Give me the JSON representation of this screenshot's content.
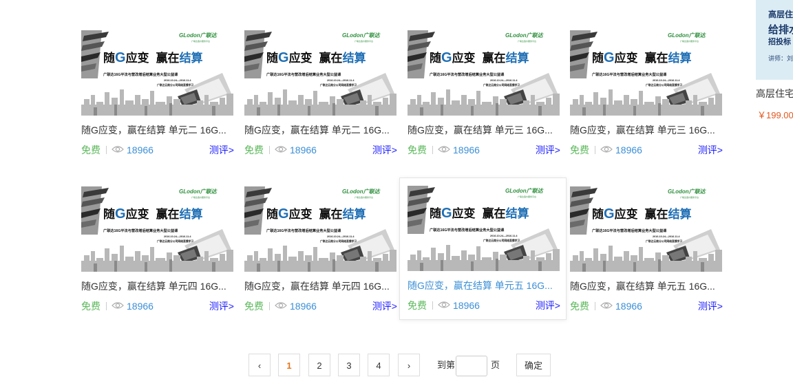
{
  "courses": [
    {
      "title": "随G应变，赢在结算 单元二 16G...",
      "price": "免费",
      "views": "18966",
      "review": "测评>",
      "thumb": {
        "logo": "GLodon广联达",
        "tagline": "广联达造价服务平台",
        "heading_a": "随",
        "heading_g": "G",
        "heading_b": "应变",
        "heading_c": "赢在",
        "heading_d": "结算",
        "subtitle": "广联达16G平法与营改增后结算业务大型公益课",
        "date": "2016.10.24—2016.11.4",
        "host": "广联达云南分公司网络直播学习"
      }
    },
    {
      "title": "随G应变，赢在结算 单元二 16G...",
      "price": "免费",
      "views": "18966",
      "review": "测评>",
      "thumb": {
        "logo": "GLodon广联达",
        "tagline": "广联达造价服务平台",
        "heading_a": "随",
        "heading_g": "G",
        "heading_b": "应变",
        "heading_c": "赢在",
        "heading_d": "结算",
        "subtitle": "广联达16G平法与营改增后结算业务大型公益课",
        "date": "2016.10.24—2016.11.4",
        "host": "广联达云南分公司网络直播学习"
      }
    },
    {
      "title": "随G应变，赢在结算 单元三 16G...",
      "price": "免费",
      "views": "18966",
      "review": "测评>",
      "thumb": {
        "logo": "GLodon广联达",
        "tagline": "广联达造价服务平台",
        "heading_a": "随",
        "heading_g": "G",
        "heading_b": "应变",
        "heading_c": "赢在",
        "heading_d": "结算",
        "subtitle": "广联达16G平法与营改增后结算业务大型公益课",
        "date": "2016.10.24—2016.11.4",
        "host": "广联达云南分公司网络直播学习"
      }
    },
    {
      "title": "随G应变，赢在结算 单元三 16G...",
      "price": "免费",
      "views": "18966",
      "review": "测评>",
      "thumb": {
        "logo": "GLodon广联达",
        "tagline": "广联达造价服务平台",
        "heading_a": "随",
        "heading_g": "G",
        "heading_b": "应变",
        "heading_c": "赢在",
        "heading_d": "结算",
        "subtitle": "广联达16G平法与营改增后结算业务大型公益课",
        "date": "2016.10.24—2016.11.4",
        "host": "广联达云南分公司网络直播学习"
      }
    },
    {
      "title": "随G应变，赢在结算 单元四 16G...",
      "price": "免费",
      "views": "18966",
      "review": "测评>",
      "thumb": {
        "logo": "GLodon广联达",
        "tagline": "广联达造价服务平台",
        "heading_a": "随",
        "heading_g": "G",
        "heading_b": "应变",
        "heading_c": "赢在",
        "heading_d": "结算",
        "subtitle": "广联达16G平法与营改增后结算业务大型公益课",
        "date": "2016.10.24—2016.11.4",
        "host": "广联达云南分公司网络直播学习"
      }
    },
    {
      "title": "随G应变，赢在结算 单元四 16G...",
      "price": "免费",
      "views": "18966",
      "review": "测评>",
      "thumb": {
        "logo": "GLodon广联达",
        "tagline": "广联达造价服务平台",
        "heading_a": "随",
        "heading_g": "G",
        "heading_b": "应变",
        "heading_c": "赢在",
        "heading_d": "结算",
        "subtitle": "广联达16G平法与营改增后结算业务大型公益课",
        "date": "2016.10.24—2016.11.4",
        "host": "广联达云南分公司网络直播学习"
      }
    },
    {
      "title": "随G应变，赢在结算 单元五 16G...",
      "price": "免费",
      "views": "18966",
      "review": "测评>",
      "thumb": {
        "logo": "GLodon广联达",
        "tagline": "广联达造价服务平台",
        "heading_a": "随",
        "heading_g": "G",
        "heading_b": "应变",
        "heading_c": "赢在",
        "heading_d": "结算",
        "subtitle": "广联达16G平法与营改增后结算业务大型公益课",
        "date": "2016.10.24—2016.11.4",
        "host": "广联达云南分公司网络直播学习"
      }
    },
    {
      "title": "随G应变，赢在结算 单元五 16G...",
      "price": "免费",
      "views": "18966",
      "review": "测评>",
      "thumb": {
        "logo": "GLodon广联达",
        "tagline": "广联达造价服务平台",
        "heading_a": "随",
        "heading_g": "G",
        "heading_b": "应变",
        "heading_c": "赢在",
        "heading_d": "结算",
        "subtitle": "广联达16G平法与营改增后结算业务大型公益课",
        "date": "2016.10.24—2016.11.4",
        "host": "广联达云南分公司网络直播学习"
      }
    }
  ],
  "pagination": {
    "prev": "‹",
    "pages": [
      "1",
      "2",
      "3",
      "4"
    ],
    "current": "1",
    "next": "›",
    "goto_prefix": "到第",
    "goto_suffix": "页",
    "goto_value": "",
    "confirm": "确定"
  },
  "side": {
    "thumb_line1": "高层住",
    "thumb_line2": "给排水",
    "thumb_line3": "招投标",
    "thumb_line4": "讲师：刘",
    "title": "高层住宅",
    "price": "￥199.00"
  }
}
